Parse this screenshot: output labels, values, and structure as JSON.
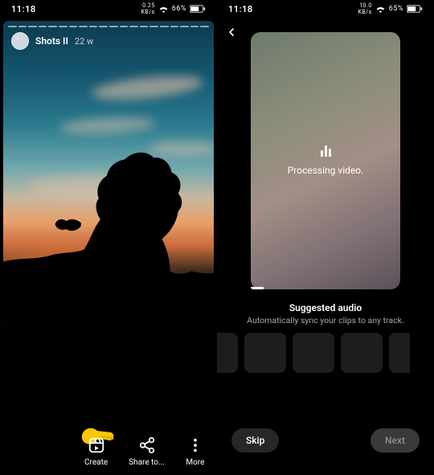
{
  "left": {
    "status": {
      "time": "11:18",
      "net_top": "0.25",
      "net_bot": "KB/s",
      "wifi": "wifi-icon",
      "battery_pct": "66%",
      "battery_icon": "battery-icon"
    },
    "story": {
      "username": "Shots II",
      "age": "22 w",
      "segments": 20
    },
    "actions": {
      "create": {
        "label": "Create",
        "icon": "reels-icon"
      },
      "share": {
        "label": "Share to...",
        "icon": "share-icon"
      },
      "more": {
        "label": "More",
        "icon": "more-vertical-icon"
      }
    },
    "pointer_icon": "pointing-hand-icon"
  },
  "right": {
    "status": {
      "time": "11:18",
      "net_top": "10.0",
      "net_bot": "KB/s",
      "wifi": "wifi-icon",
      "battery_pct": "65%",
      "battery_icon": "battery-icon"
    },
    "back_icon": "chevron-left-icon",
    "preview": {
      "processing_icon": "audio-wave-icon",
      "processing_text": "Processing video."
    },
    "suggested": {
      "title": "Suggested audio",
      "subtitle": "Automatically sync your clips to any track."
    },
    "tiles_count": 5,
    "nav": {
      "skip": "Skip",
      "next": "Next"
    }
  }
}
